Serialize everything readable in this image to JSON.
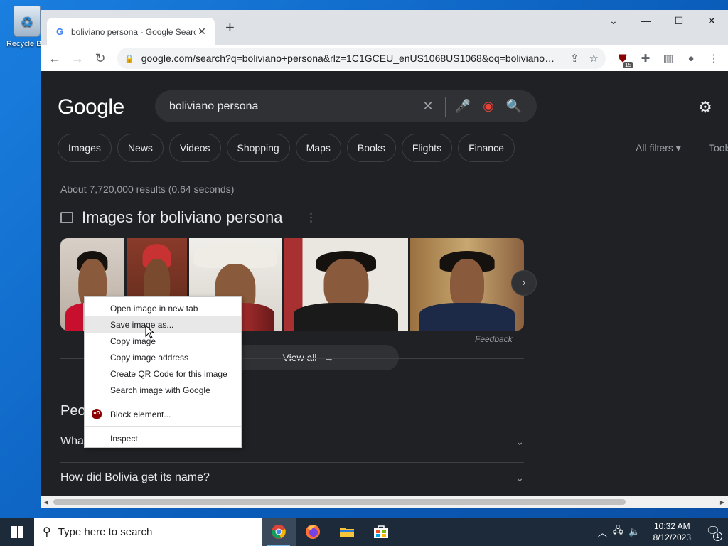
{
  "desktop": {
    "recycle_label": "Recycle Bin"
  },
  "browser": {
    "tab_title": "boliviano persona - Google Search",
    "url": "google.com/search?q=boliviano+persona&rlz=1C1GCEU_enUS1068US1068&oq=boliviano+per...",
    "extension_badge": "15"
  },
  "google": {
    "logo": "Google",
    "query": "boliviano persona",
    "chips": [
      "Images",
      "News",
      "Videos",
      "Shopping",
      "Maps",
      "Books",
      "Flights",
      "Finance"
    ],
    "all_filters": "All filters ▾",
    "tools": "Tools",
    "stats": "About 7,720,000 results (0.64 seconds)",
    "images_heading": "Images for boliviano persona",
    "feedback": "Feedback",
    "view_all": "View all",
    "paa_heading": "People also ask",
    "questions": [
      "What is Bolivia famous for?",
      "How did Bolivia get its name?"
    ]
  },
  "context_menu": {
    "items": [
      "Open image in new tab",
      "Save image as...",
      "Copy image",
      "Copy image address",
      "Create QR Code for this image",
      "Search image with Google"
    ],
    "block": "Block element...",
    "inspect": "Inspect",
    "hovered_index": 1
  },
  "taskbar": {
    "search_placeholder": "Type here to search",
    "time": "10:32 AM",
    "date": "8/12/2023",
    "notification_count": "1"
  },
  "colors": {
    "accent": "#8ab4f8",
    "page_bg": "#202124",
    "chrome_frame": "#dee1e6"
  }
}
